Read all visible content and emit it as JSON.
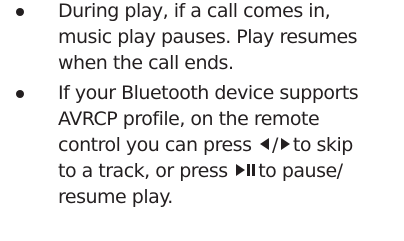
{
  "bullets": [
    {
      "lines": [
        "During play, if a call comes in,",
        "music play pauses. Play resumes",
        "when the call ends."
      ]
    },
    {
      "lines": [
        "If your Bluetooth device supports",
        "AVRCP profile, on the remote"
      ],
      "line3_pre": "control you can press",
      "line3_slash": "/",
      "line3_post": "to skip",
      "line4_pre": "to a track, or press",
      "line4_post": "to pause/",
      "line5": "resume play.",
      "icons": [
        "skip-back-triangle-icon",
        "skip-forward-triangle-icon",
        "play-pause-icon"
      ]
    }
  ]
}
